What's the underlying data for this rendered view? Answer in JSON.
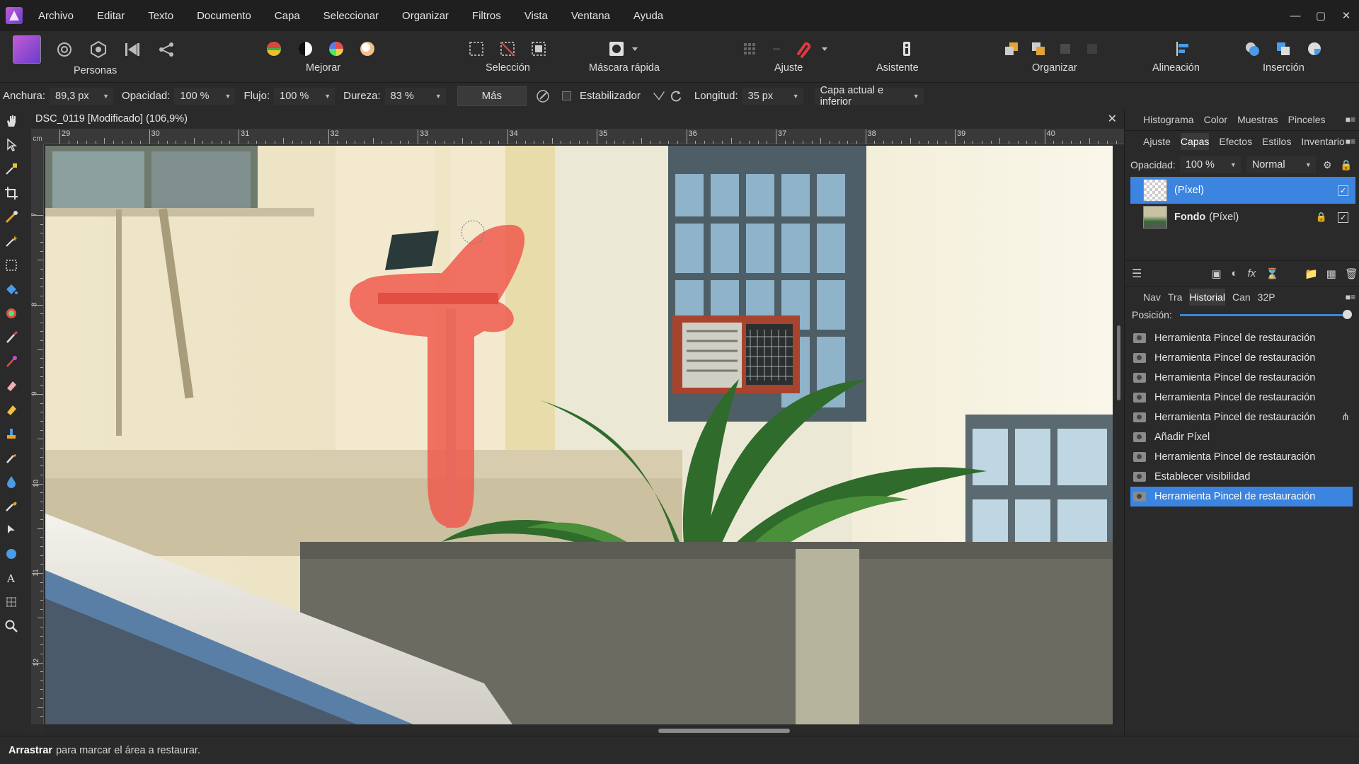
{
  "menu": [
    "Archivo",
    "Editar",
    "Texto",
    "Documento",
    "Capa",
    "Seleccionar",
    "Organizar",
    "Filtros",
    "Vista",
    "Ventana",
    "Ayuda"
  ],
  "toolbar": {
    "groups": {
      "personas": "Personas",
      "mejorar": "Mejorar",
      "seleccion": "Selección",
      "mascara": "Máscara rápida",
      "ajuste": "Ajuste",
      "asistente": "Asistente",
      "organizar": "Organizar",
      "alineacion": "Alineación",
      "insercion": "Inserción"
    }
  },
  "context": {
    "anchura_label": "Anchura:",
    "anchura_value": "89,3 px",
    "opacidad_label": "Opacidad:",
    "opacidad_value": "100 %",
    "flujo_label": "Flujo:",
    "flujo_value": "100 %",
    "dureza_label": "Dureza:",
    "dureza_value": "83 %",
    "mas_label": "Más",
    "estabilizador_label": "Estabilizador",
    "longitud_label": "Longitud:",
    "longitud_value": "35 px",
    "source_value": "Capa actual e inferior"
  },
  "document": {
    "title": "DSC_0119 [Modificado] (106,9%)",
    "ruler_unit": "cm",
    "ruler_h": [
      "29",
      "30",
      "31",
      "32",
      "33",
      "34",
      "35",
      "36",
      "37",
      "38",
      "39",
      "40"
    ],
    "ruler_v": [
      "7",
      "8",
      "9",
      "10",
      "11",
      "12"
    ]
  },
  "panels": {
    "top_tabs": [
      "Histograma",
      "Color",
      "Muestras",
      "Pinceles"
    ],
    "second_tabs": [
      "Ajuste",
      "Capas",
      "Efectos",
      "Estilos",
      "Inventario"
    ],
    "second_active": "Capas",
    "opacity_label": "Opacidad:",
    "opacity_value": "100 %",
    "blend_mode": "Normal",
    "layers": [
      {
        "name": "(Píxel)",
        "selected": true
      },
      {
        "name": "Fondo",
        "suffix": "(Píxel)",
        "selected": false,
        "locked": true
      }
    ],
    "bottom_tabs": [
      "Nav",
      "Tra",
      "Historial",
      "Can",
      "32P"
    ],
    "bottom_active": "Historial",
    "position_label": "Posición:",
    "history": [
      "Herramienta Pincel de restauración",
      "Herramienta Pincel de restauración",
      "Herramienta Pincel de restauración",
      "Herramienta Pincel de restauración",
      "Herramienta Pincel de restauración",
      "Añadir Píxel",
      "Herramienta Pincel de restauración",
      "Establecer visibilidad",
      "Herramienta Pincel de restauración"
    ]
  },
  "status": {
    "bold": "Arrastrar",
    "text": "para marcar el área a restaurar."
  },
  "colors": {
    "accent": "#3b84e0",
    "mask": "#f05a4d"
  }
}
